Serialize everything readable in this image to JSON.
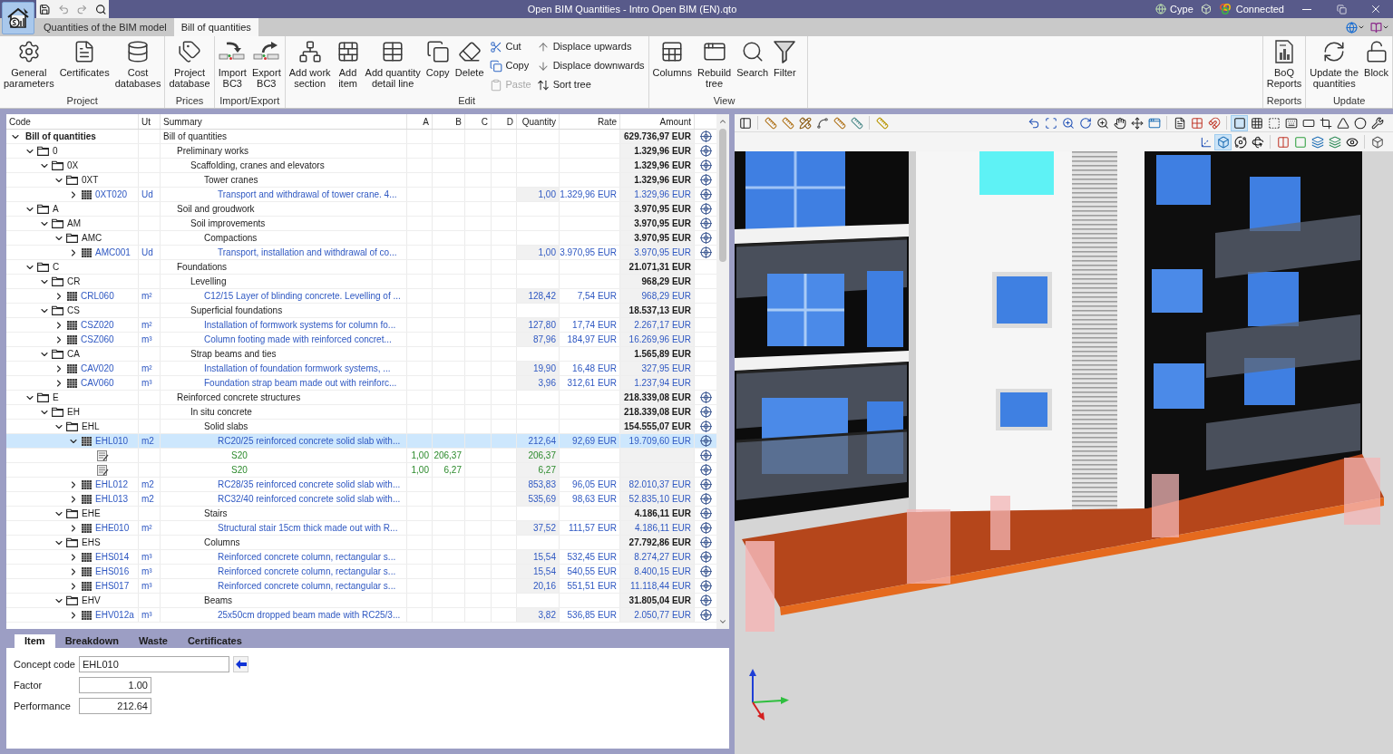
{
  "window": {
    "title": "Open BIM Quantities - Intro Open BIM (EN).qto",
    "account": "Cype",
    "connection": "Connected"
  },
  "tabs": [
    {
      "label": "Quantities of the BIM model",
      "selected": false
    },
    {
      "label": "Bill of quantities",
      "selected": true
    }
  ],
  "ribbon": {
    "groups": [
      {
        "label": "Project",
        "buttons": [
          {
            "label": "General parameters",
            "kind": "large",
            "disabled": false
          },
          {
            "label": "Certificates",
            "kind": "large",
            "disabled": false
          },
          {
            "label": "Cost databases",
            "kind": "large",
            "disabled": false
          }
        ]
      },
      {
        "label": "Prices",
        "buttons": [
          {
            "label": "Project database",
            "kind": "large",
            "disabled": false
          }
        ]
      },
      {
        "label": "Import/Export",
        "buttons": [
          {
            "label": "Import BC3",
            "kind": "large",
            "disabled": false
          },
          {
            "label": "Export BC3",
            "kind": "large",
            "disabled": false
          }
        ]
      },
      {
        "label": "Edit",
        "buttons": [
          {
            "label": "Add work section",
            "kind": "large",
            "disabled": false
          },
          {
            "label": "Add item",
            "kind": "large",
            "disabled": false
          },
          {
            "label": "Add quantity detail line",
            "kind": "large",
            "disabled": false
          },
          {
            "label": "Copy",
            "kind": "large",
            "disabled": false
          },
          {
            "label": "Delete",
            "kind": "large",
            "disabled": false
          },
          {
            "label": "Cut",
            "kind": "small",
            "disabled": false
          },
          {
            "label": "Copy",
            "kind": "small",
            "disabled": false
          },
          {
            "label": "Paste",
            "kind": "small",
            "disabled": true
          },
          {
            "label": "Displace upwards",
            "kind": "small",
            "disabled": false
          },
          {
            "label": "Displace downwards",
            "kind": "small",
            "disabled": false
          },
          {
            "label": "Sort tree",
            "kind": "small",
            "disabled": false
          }
        ]
      },
      {
        "label": "View",
        "buttons": [
          {
            "label": "Columns",
            "kind": "large",
            "disabled": false
          },
          {
            "label": "Rebuild tree",
            "kind": "large",
            "disabled": false
          },
          {
            "label": "Search",
            "kind": "large",
            "disabled": false
          },
          {
            "label": "Filter",
            "kind": "large",
            "disabled": false
          }
        ]
      },
      {
        "label": "Reports",
        "buttons": [
          {
            "label": "BoQ Reports",
            "kind": "large",
            "disabled": false
          }
        ]
      },
      {
        "label": "Update",
        "buttons": [
          {
            "label": "Update the quantities",
            "kind": "large",
            "disabled": false
          },
          {
            "label": "Block",
            "kind": "large",
            "disabled": false
          }
        ]
      }
    ]
  },
  "table": {
    "columns": [
      "Code",
      "Ut",
      "Summary",
      "A",
      "B",
      "C",
      "D",
      "Quantity",
      "Rate",
      "Amount"
    ],
    "rows": [
      {
        "kind": "root",
        "code": "Bill of quantities",
        "summary": "Bill of quantities",
        "amount": "629.736,97 EUR",
        "linked": true,
        "expanded": true,
        "selected": false,
        "children": [
          {
            "kind": "chapter",
            "code": "0",
            "summary": "Preliminary works",
            "amount": "1.329,96 EUR",
            "linked": true,
            "expanded": true,
            "selected": false,
            "children": [
              {
                "kind": "chapter",
                "code": "0X",
                "summary": "Scaffolding, cranes and elevators",
                "amount": "1.329,96 EUR",
                "linked": true,
                "expanded": true,
                "selected": false,
                "children": [
                  {
                    "kind": "chapter",
                    "code": "0XT",
                    "summary": "Tower cranes",
                    "amount": "1.329,96 EUR",
                    "linked": true,
                    "expanded": true,
                    "selected": false,
                    "children": [
                      {
                        "kind": "item",
                        "code": "0XT020",
                        "unit": "Ud",
                        "summary": "Transport and withdrawal of tower crane. 4...",
                        "quantity": "1,00",
                        "rate": "1.329,96 EUR",
                        "amount": "1.329,96 EUR",
                        "linked": true,
                        "expanded": false,
                        "selected": false
                      }
                    ]
                  }
                ]
              }
            ]
          },
          {
            "kind": "chapter",
            "code": "A",
            "summary": "Soil and groudwork",
            "amount": "3.970,95 EUR",
            "linked": true,
            "expanded": true,
            "selected": false,
            "children": [
              {
                "kind": "chapter",
                "code": "AM",
                "summary": "Soil improvements",
                "amount": "3.970,95 EUR",
                "linked": true,
                "expanded": true,
                "selected": false,
                "children": [
                  {
                    "kind": "chapter",
                    "code": "AMC",
                    "summary": "Compactions",
                    "amount": "3.970,95 EUR",
                    "linked": true,
                    "expanded": true,
                    "selected": false,
                    "children": [
                      {
                        "kind": "item",
                        "code": "AMC001",
                        "unit": "Ud",
                        "summary": "Transport, installation and withdrawal of co...",
                        "quantity": "1,00",
                        "rate": "3.970,95 EUR",
                        "amount": "3.970,95 EUR",
                        "linked": true,
                        "expanded": false,
                        "selected": false
                      }
                    ]
                  }
                ]
              }
            ]
          },
          {
            "kind": "chapter",
            "code": "C",
            "summary": "Foundations",
            "amount": "21.071,31 EUR",
            "linked": false,
            "expanded": true,
            "selected": false,
            "children": [
              {
                "kind": "chapter",
                "code": "CR",
                "summary": "Levelling",
                "amount": "968,29 EUR",
                "linked": false,
                "expanded": true,
                "selected": false,
                "children": [
                  {
                    "kind": "item",
                    "code": "CRL060",
                    "unit": "m²",
                    "summary": "C12/15 Layer of blinding concrete. Levelling of ...",
                    "quantity": "128,42",
                    "rate": "7,54 EUR",
                    "amount": "968,29 EUR",
                    "linked": false,
                    "expanded": false,
                    "selected": false
                  }
                ]
              },
              {
                "kind": "chapter",
                "code": "CS",
                "summary": "Superficial foundations",
                "amount": "18.537,13 EUR",
                "linked": false,
                "expanded": true,
                "selected": false,
                "children": [
                  {
                    "kind": "item",
                    "code": "CSZ020",
                    "unit": "m²",
                    "summary": "Installation of formwork systems for column fo...",
                    "quantity": "127,80",
                    "rate": "17,74 EUR",
                    "amount": "2.267,17 EUR",
                    "linked": false,
                    "expanded": false,
                    "selected": false
                  },
                  {
                    "kind": "item",
                    "code": "CSZ060",
                    "unit": "m³",
                    "summary": "Column footing made with reinforced concret...",
                    "quantity": "87,96",
                    "rate": "184,97 EUR",
                    "amount": "16.269,96 EUR",
                    "linked": false,
                    "expanded": false,
                    "selected": false
                  }
                ]
              },
              {
                "kind": "chapter",
                "code": "CA",
                "summary": "Strap beams and ties",
                "amount": "1.565,89 EUR",
                "linked": false,
                "expanded": true,
                "selected": false,
                "children": [
                  {
                    "kind": "item",
                    "code": "CAV020",
                    "unit": "m²",
                    "summary": "Installation of foundation formwork systems, ...",
                    "quantity": "19,90",
                    "rate": "16,48 EUR",
                    "amount": "327,95 EUR",
                    "linked": false,
                    "expanded": false,
                    "selected": false
                  },
                  {
                    "kind": "item",
                    "code": "CAV060",
                    "unit": "m³",
                    "summary": "Foundation strap beam made out with reinforc...",
                    "quantity": "3,96",
                    "rate": "312,61 EUR",
                    "amount": "1.237,94 EUR",
                    "linked": false,
                    "expanded": false,
                    "selected": false
                  }
                ]
              }
            ]
          },
          {
            "kind": "chapter",
            "code": "E",
            "summary": "Reinforced concrete structures",
            "amount": "218.339,08 EUR",
            "linked": true,
            "expanded": true,
            "selected": false,
            "children": [
              {
                "kind": "chapter",
                "code": "EH",
                "summary": "In situ concrete",
                "amount": "218.339,08 EUR",
                "linked": true,
                "expanded": true,
                "selected": false,
                "children": [
                  {
                    "kind": "chapter",
                    "code": "EHL",
                    "summary": "Solid slabs",
                    "amount": "154.555,07 EUR",
                    "linked": true,
                    "expanded": true,
                    "selected": false,
                    "children": [
                      {
                        "kind": "item",
                        "code": "EHL010",
                        "unit": "m2",
                        "summary": "RC20/25 reinforced concrete solid slab with...",
                        "quantity": "212,64",
                        "rate": "92,69 EUR",
                        "amount": "19.709,60 EUR",
                        "linked": true,
                        "expanded": true,
                        "selected": true,
                        "children": [
                          {
                            "kind": "line",
                            "summary": "S20",
                            "a": "1,00",
                            "b": "206,37",
                            "quantity": "206,37",
                            "linked": true,
                            "selected": false
                          },
                          {
                            "kind": "line",
                            "summary": "S20",
                            "a": "1,00",
                            "b": "6,27",
                            "quantity": "6,27",
                            "linked": true,
                            "selected": false
                          }
                        ]
                      },
                      {
                        "kind": "item",
                        "code": "EHL012",
                        "unit": "m2",
                        "summary": "RC28/35 reinforced concrete solid slab with...",
                        "quantity": "853,83",
                        "rate": "96,05 EUR",
                        "amount": "82.010,37 EUR",
                        "linked": true,
                        "expanded": false,
                        "selected": false
                      },
                      {
                        "kind": "item",
                        "code": "EHL013",
                        "unit": "m2",
                        "summary": "RC32/40 reinforced concrete solid slab with...",
                        "quantity": "535,69",
                        "rate": "98,63 EUR",
                        "amount": "52.835,10 EUR",
                        "linked": true,
                        "expanded": false,
                        "selected": false
                      }
                    ]
                  },
                  {
                    "kind": "chapter",
                    "code": "EHE",
                    "summary": "Stairs",
                    "amount": "4.186,11 EUR",
                    "linked": true,
                    "expanded": true,
                    "selected": false,
                    "children": [
                      {
                        "kind": "item",
                        "code": "EHE010",
                        "unit": "m²",
                        "summary": "Structural stair 15cm thick made out with R...",
                        "quantity": "37,52",
                        "rate": "111,57 EUR",
                        "amount": "4.186,11 EUR",
                        "linked": true,
                        "expanded": false,
                        "selected": false
                      }
                    ]
                  },
                  {
                    "kind": "chapter",
                    "code": "EHS",
                    "summary": "Columns",
                    "amount": "27.792,86 EUR",
                    "linked": true,
                    "expanded": true,
                    "selected": false,
                    "children": [
                      {
                        "kind": "item",
                        "code": "EHS014",
                        "unit": "m³",
                        "summary": "Reinforced concrete column, rectangular s...",
                        "quantity": "15,54",
                        "rate": "532,45 EUR",
                        "amount": "8.274,27 EUR",
                        "linked": true,
                        "expanded": false,
                        "selected": false
                      },
                      {
                        "kind": "item",
                        "code": "EHS016",
                        "unit": "m³",
                        "summary": "Reinforced concrete column, rectangular s...",
                        "quantity": "15,54",
                        "rate": "540,55 EUR",
                        "amount": "8.400,15 EUR",
                        "linked": true,
                        "expanded": false,
                        "selected": false
                      },
                      {
                        "kind": "item",
                        "code": "EHS017",
                        "unit": "m³",
                        "summary": "Reinforced concrete column, rectangular s...",
                        "quantity": "20,16",
                        "rate": "551,51 EUR",
                        "amount": "11.118,44 EUR",
                        "linked": true,
                        "expanded": false,
                        "selected": false
                      }
                    ]
                  },
                  {
                    "kind": "chapter",
                    "code": "EHV",
                    "summary": "Beams",
                    "amount": "31.805,04 EUR",
                    "linked": true,
                    "expanded": true,
                    "selected": false,
                    "children": [
                      {
                        "kind": "item",
                        "code": "EHV012a",
                        "unit": "m³",
                        "summary": "25x50cm dropped beam made with RC25/3...",
                        "quantity": "3,82",
                        "rate": "536,85 EUR",
                        "amount": "2.050,77 EUR",
                        "linked": true,
                        "expanded": false,
                        "selected": false
                      }
                    ]
                  }
                ]
              }
            ]
          }
        ]
      }
    ]
  },
  "detail_panel": {
    "tabs": [
      {
        "label": "Item",
        "selected": true
      },
      {
        "label": "Breakdown",
        "selected": false
      },
      {
        "label": "Waste",
        "selected": false
      },
      {
        "label": "Certificates",
        "selected": false
      }
    ],
    "fields": [
      {
        "kind": "code",
        "label": "Concept code",
        "value": "EHL010"
      },
      {
        "kind": "number",
        "label": "Factor",
        "value": "1.00"
      },
      {
        "kind": "number",
        "label": "Performance",
        "value": "212.64"
      }
    ]
  },
  "viewer_toolbar": {
    "top_row": [
      {
        "selected": false
      },
      {
        "selected": false
      },
      {
        "selected": false
      },
      {
        "selected": false
      },
      {
        "selected": false
      },
      {
        "selected": false
      },
      {
        "selected": false
      },
      {
        "selected": false
      },
      {
        "selected": false
      },
      {
        "selected": false
      },
      {
        "selected": false
      },
      {
        "selected": false
      },
      {
        "selected": false
      },
      {
        "selected": false
      },
      {
        "selected": false
      },
      {
        "selected": false
      },
      {
        "selected": false
      },
      {
        "selected": false
      },
      {
        "selected": false
      },
      {
        "selected": true
      },
      {
        "selected": false
      },
      {
        "selected": false
      },
      {
        "selected": false
      },
      {
        "selected": false
      },
      {
        "selected": false
      },
      {
        "selected": false
      },
      {
        "selected": false
      },
      {
        "selected": false
      }
    ],
    "bottom_row": [
      {
        "selected": false
      },
      {
        "selected": true
      },
      {
        "selected": false
      },
      {
        "selected": false
      },
      {
        "selected": false
      },
      {
        "selected": false
      },
      {
        "selected": false
      },
      {
        "selected": false
      },
      {
        "selected": false
      },
      {
        "selected": false
      }
    ]
  }
}
